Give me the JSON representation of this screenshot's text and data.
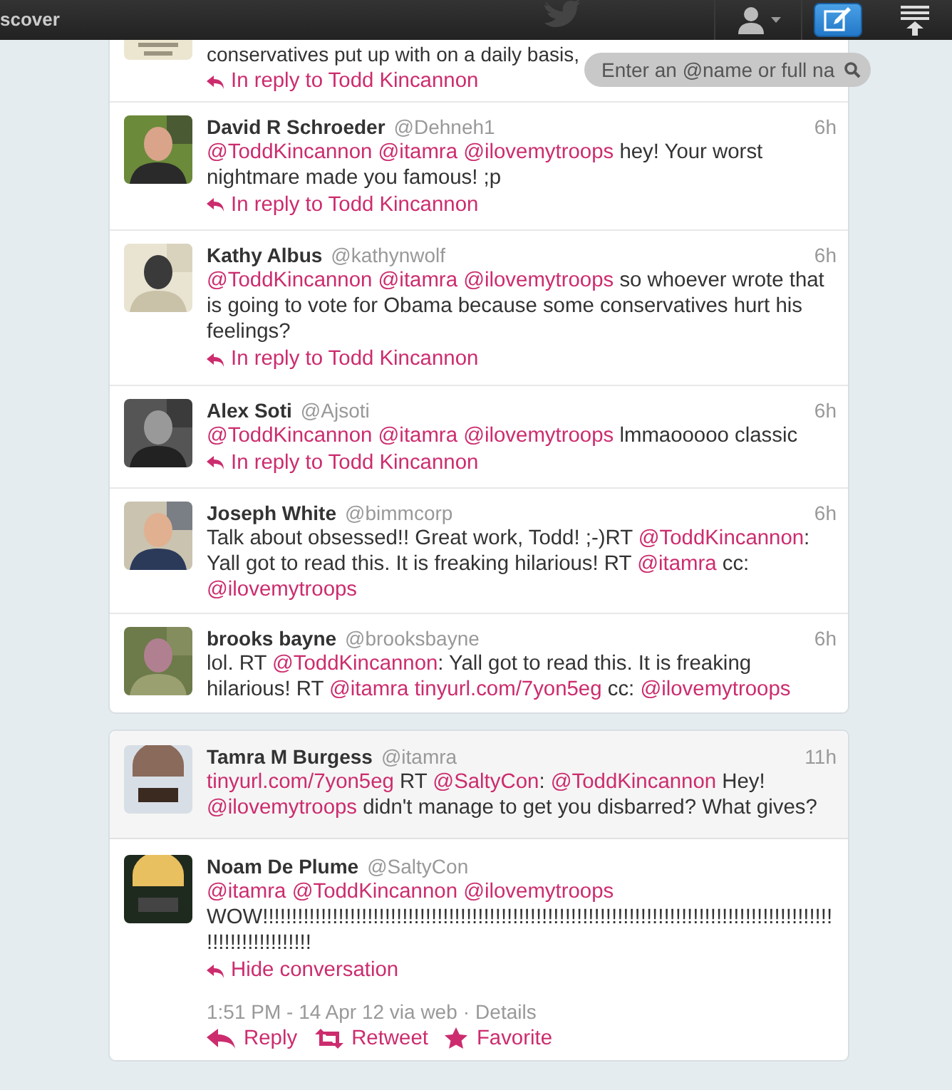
{
  "top_bar": {
    "nav_label": "scover"
  },
  "search": {
    "placeholder": "Enter an @name or full na"
  },
  "partial_tweet": {
    "text": "conservatives put up with on a daily basis,",
    "reply_link": "In reply to Todd Kincannon"
  },
  "tweets": [
    {
      "name": "David R Schroeder",
      "handle": "@Dehneh1",
      "time": "6h",
      "parts": [
        {
          "kind": "mention",
          "text": "@ToddKincannon"
        },
        {
          "kind": "mention",
          "text": "@itamra"
        },
        {
          "kind": "mention",
          "text": "@ilovemytroops"
        },
        {
          "kind": "plain",
          "text": " hey! Your worst nightmare made you famous! ;p"
        }
      ],
      "reply_link": "In reply to Todd Kincannon"
    },
    {
      "name": "Kathy Albus",
      "handle": "@kathynwolf",
      "time": "6h",
      "parts": [
        {
          "kind": "mention",
          "text": "@ToddKincannon"
        },
        {
          "kind": "mention",
          "text": "@itamra"
        },
        {
          "kind": "mention",
          "text": "@ilovemytroops"
        },
        {
          "kind": "plain",
          "text": " so whoever wrote that is going to vote for Obama because some conservatives hurt his feelings?"
        }
      ],
      "reply_link": "In reply to Todd Kincannon"
    },
    {
      "name": "Alex Soti",
      "handle": "@Ajsoti",
      "time": "6h",
      "parts": [
        {
          "kind": "mention",
          "text": "@ToddKincannon"
        },
        {
          "kind": "mention",
          "text": "@itamra"
        },
        {
          "kind": "mention",
          "text": "@ilovemytroops"
        },
        {
          "kind": "plain",
          "text": " lmmaooooo classic"
        }
      ],
      "reply_link": "In reply to Todd Kincannon"
    },
    {
      "name": "Joseph White",
      "handle": "@bimmcorp",
      "time": "6h",
      "parts": [
        {
          "kind": "plain",
          "text": "Talk about obsessed!! Great work, Todd! ;-)RT "
        },
        {
          "kind": "mention",
          "text": "@ToddKincannon"
        },
        {
          "kind": "plain",
          "text": ": Yall got to read this. It is freaking hilarious! RT "
        },
        {
          "kind": "mention",
          "text": "@itamra"
        },
        {
          "kind": "plain",
          "text": " cc: "
        },
        {
          "kind": "mention",
          "text": "@ilovemytroops"
        }
      ]
    },
    {
      "name": "brooks bayne",
      "handle": "@brooksbayne",
      "time": "6h",
      "parts": [
        {
          "kind": "plain",
          "text": "lol. RT "
        },
        {
          "kind": "mention",
          "text": "@ToddKincannon"
        },
        {
          "kind": "plain",
          "text": ": Yall got to read this. It is freaking hilarious! RT "
        },
        {
          "kind": "mention",
          "text": "@itamra"
        },
        {
          "kind": "url",
          "text": "tinyurl.com/7yon5eg"
        },
        {
          "kind": "plain",
          "text": " cc: "
        },
        {
          "kind": "mention",
          "text": "@ilovemytroops"
        }
      ]
    }
  ],
  "conversation": {
    "tweets": [
      {
        "name": "Tamra M Burgess",
        "handle": "@itamra",
        "time": "11h",
        "parts": [
          {
            "kind": "url",
            "text": "tinyurl.com/7yon5eg"
          },
          {
            "kind": "plain",
            "text": " RT "
          },
          {
            "kind": "mention",
            "text": "@SaltyCon"
          },
          {
            "kind": "plain",
            "text": ": "
          },
          {
            "kind": "mention",
            "text": "@ToddKincannon"
          },
          {
            "kind": "plain",
            "text": " Hey! "
          },
          {
            "kind": "mention",
            "text": "@ilovemytroops"
          },
          {
            "kind": "plain",
            "text": " didn't manage to get you disbarred? What gives?"
          }
        ]
      },
      {
        "name": "Noam De Plume",
        "handle": "@SaltyCon",
        "parts": [
          {
            "kind": "mention",
            "text": "@itamra"
          },
          {
            "kind": "mention",
            "text": "@ToddKincannon"
          },
          {
            "kind": "mention",
            "text": "@ilovemytroops"
          },
          {
            "kind": "plain",
            "text": " WOW!!!!!!!!!!!!!!!!!!!!!!!!!!!!!!!!!!!!!!!!!!!!!!!!!!!!!!!!!!!!!!!!!!!!!!!!!!!!!!!!!!!!!!!!!!!!!!!!!!!!!!!!!!!!!!!!!!!!"
          }
        ]
      }
    ],
    "hide_link": "Hide conversation",
    "meta": "1:51 PM - 14 Apr 12 via web",
    "separator": "·",
    "details": "Details",
    "actions": [
      {
        "kind": "reply",
        "label": "Reply"
      },
      {
        "kind": "retweet",
        "label": "Retweet"
      },
      {
        "kind": "favorite",
        "label": "Favorite"
      }
    ]
  }
}
